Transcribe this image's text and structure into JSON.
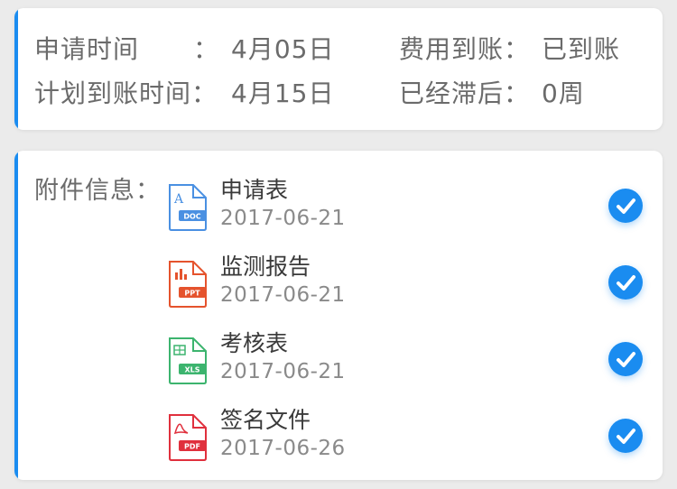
{
  "summary": {
    "apply_time_label": "申请时间",
    "apply_time_colon": "：",
    "apply_time_value": "4月05日",
    "expense_label": "费用到账：",
    "expense_value": "已到账",
    "planned_label": "计划到账时间：",
    "planned_value": "4月15日",
    "delay_label": "已经滞后：",
    "delay_value": "0周"
  },
  "attachments": {
    "label": "附件信息：",
    "items": [
      {
        "name": "申请表",
        "date": "2017-06-21",
        "type": "DOC",
        "icon": "doc-file-icon",
        "color": "#4a90e2",
        "checked": true
      },
      {
        "name": "监测报告",
        "date": "2017-06-21",
        "type": "PPT",
        "icon": "ppt-file-icon",
        "color": "#e5532d",
        "checked": true
      },
      {
        "name": "考核表",
        "date": "2017-06-21",
        "type": "XLS",
        "icon": "xls-file-icon",
        "color": "#3cb46e",
        "checked": true
      },
      {
        "name": "签名文件",
        "date": "2017-06-26",
        "type": "PDF",
        "icon": "pdf-file-icon",
        "color": "#e0303d",
        "checked": true
      }
    ]
  },
  "colors": {
    "accent": "#1a8cf0",
    "background": "#ebebeb",
    "card": "#ffffff"
  }
}
